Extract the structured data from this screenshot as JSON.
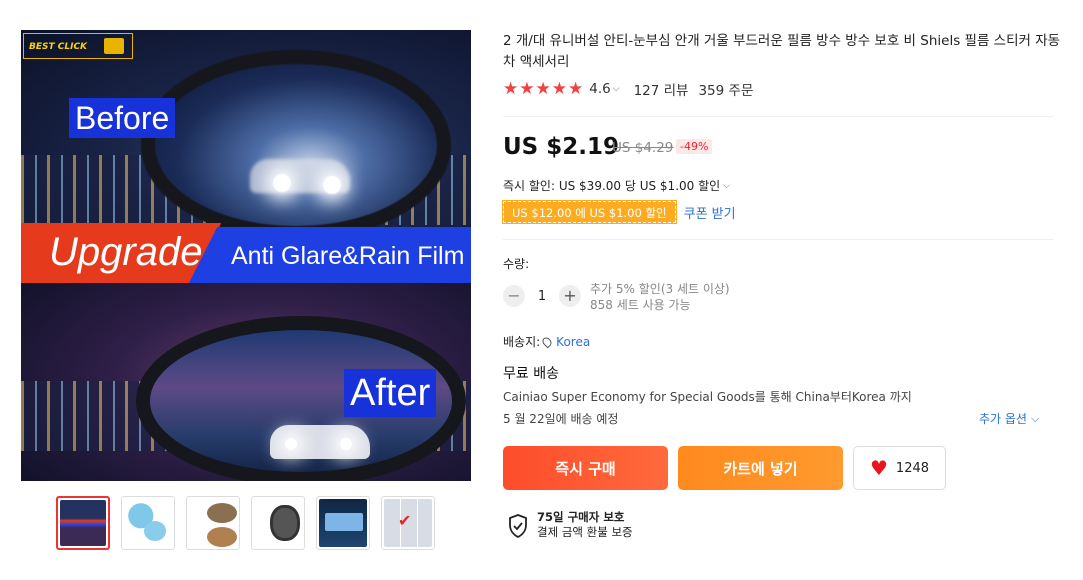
{
  "gallery": {
    "stamp_text": "BEST CLICK",
    "before_label": "Before",
    "after_label": "After",
    "upgrade_label": "Upgrade",
    "film_label": "Anti Glare&Rain Film",
    "thumbnails": [
      {
        "name": "thumb-1",
        "active": true
      },
      {
        "name": "thumb-2",
        "active": false
      },
      {
        "name": "thumb-3",
        "active": false
      },
      {
        "name": "thumb-4",
        "active": false
      },
      {
        "name": "thumb-5",
        "active": false
      },
      {
        "name": "thumb-6",
        "active": false
      }
    ]
  },
  "product": {
    "title": "2 개/대 유니버설 안티-눈부심 안개 거울 부드러운 필름 방수 방수 보호 비 Shiels 필름 스티커 자동차 액세서리",
    "rating": "4.6",
    "reviews": "127 리뷰",
    "orders": "359 주문",
    "price": "US $2.19",
    "original_price": "US $4.29",
    "discount": "-49%"
  },
  "promo": {
    "instant_discount": "즉시 할인: US $39.00 당 US $1.00 할인",
    "coupon_tag": "US $12.00 에 US $1.00 할인",
    "coupon_link": "쿠폰 받기"
  },
  "quantity": {
    "label": "수량:",
    "minus": "−",
    "value": "1",
    "plus": "+",
    "bulk_discount": "추가 5% 할인(3 세트 이상)",
    "available": "858 세트 사용 가능"
  },
  "shipping": {
    "ship_to_label": "배송지:",
    "country": "Korea",
    "free_shipping": "무료 배송",
    "carrier": "Cainiao Super Economy for Special Goods를 통해 China부터Korea 까지",
    "eta": "5 월 22일에 배송 예정",
    "more_options": "추가 옵션"
  },
  "actions": {
    "buy_now": "즉시 구매",
    "add_to_cart": "카트에 넣기",
    "wishlist_count": "1248"
  },
  "protection": {
    "line1": "75일 구매자 보호",
    "line2": "결제 금액 환불 보증"
  },
  "colors": {
    "accent_red": "#fe4c2b",
    "accent_orange": "#ff8a1e",
    "star_red": "#f04243",
    "link_blue": "#2a71d8",
    "coupon_yellow": "#fdab21"
  }
}
